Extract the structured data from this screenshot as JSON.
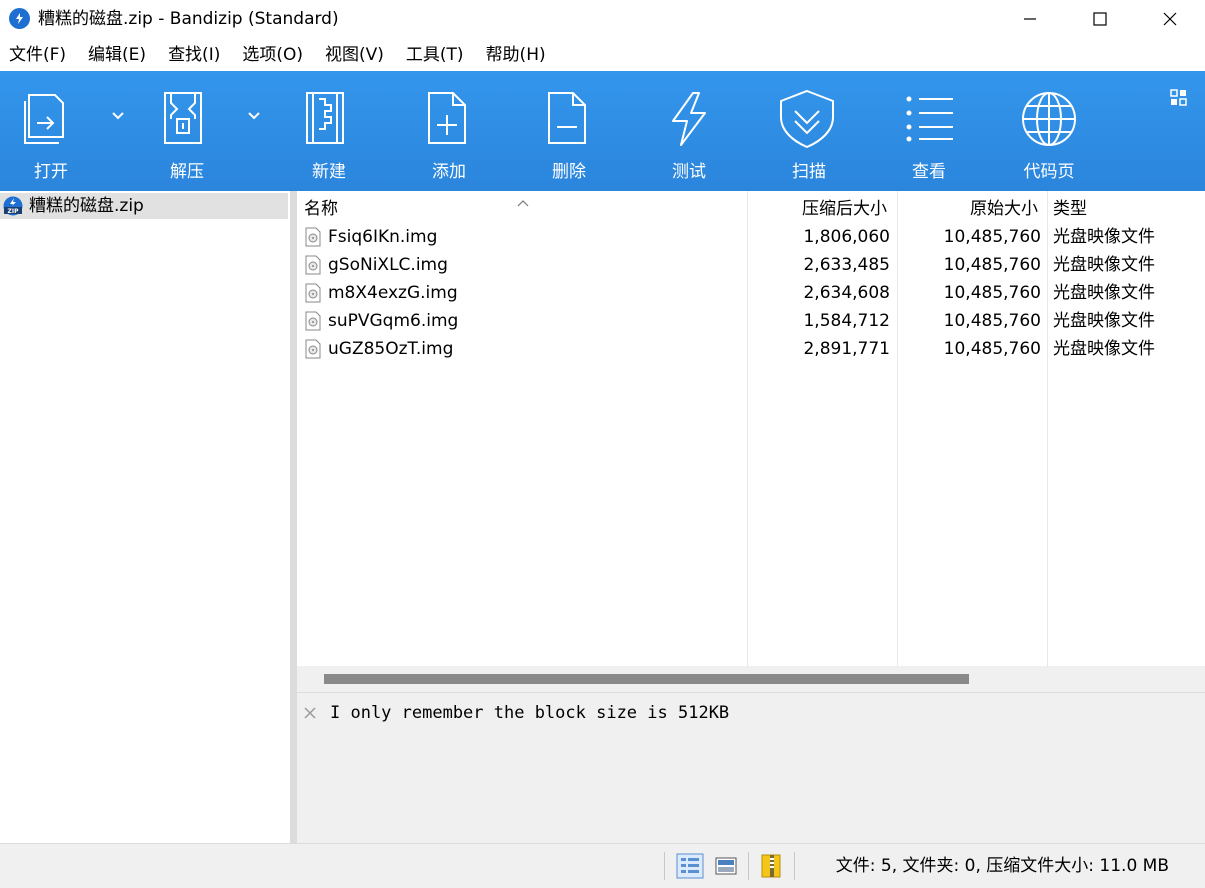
{
  "window": {
    "title": "糟糕的磁盘.zip - Bandizip (Standard)",
    "icon": "bandizip-app-icon",
    "controls": [
      "minimize-icon",
      "maximize-icon",
      "close-icon"
    ]
  },
  "menu": {
    "items": [
      "文件(F)",
      "编辑(E)",
      "查找(I)",
      "选项(O)",
      "视图(V)",
      "工具(T)",
      "帮助(H)"
    ]
  },
  "toolbar": {
    "background": "#2f8fe6",
    "buttons": [
      {
        "label": "打开",
        "icon": "open-archive-icon",
        "has_dropdown": true
      },
      {
        "label": "解压",
        "icon": "extract-icon",
        "has_dropdown": true
      },
      {
        "label": "新建",
        "icon": "new-archive-icon"
      },
      {
        "label": "添加",
        "icon": "add-file-icon"
      },
      {
        "label": "删除",
        "icon": "delete-file-icon"
      },
      {
        "label": "测试",
        "icon": "test-lightning-icon"
      },
      {
        "label": "扫描",
        "icon": "scan-shield-icon"
      },
      {
        "label": "查看",
        "icon": "view-list-icon"
      },
      {
        "label": "代码页",
        "icon": "codepage-globe-icon"
      }
    ],
    "layout_icon": "layout-grid-icon"
  },
  "tree": {
    "items": [
      {
        "label": "糟糕的磁盘.zip",
        "icon": "zip-icon",
        "selected": true
      }
    ]
  },
  "filelist": {
    "columns": {
      "name": "名称",
      "compressed": "压缩后大小",
      "original": "原始大小",
      "type": "类型"
    },
    "sort_column": "name",
    "rows": [
      {
        "name": "Fsiq6IKn.img",
        "compressed": "1,806,060",
        "original": "10,485,760",
        "type": "光盘映像文件"
      },
      {
        "name": "gSoNiXLC.img",
        "compressed": "2,633,485",
        "original": "10,485,760",
        "type": "光盘映像文件"
      },
      {
        "name": "m8X4exzG.img",
        "compressed": "2,634,608",
        "original": "10,485,760",
        "type": "光盘映像文件"
      },
      {
        "name": "suPVGqm6.img",
        "compressed": "1,584,712",
        "original": "10,485,760",
        "type": "光盘映像文件"
      },
      {
        "name": "uGZ85OzT.img",
        "compressed": "2,891,771",
        "original": "10,485,760",
        "type": "光盘映像文件"
      }
    ]
  },
  "comment": {
    "text": "I only remember the block size is 512KB"
  },
  "status": {
    "text": "文件: 5, 文件夹: 0, 压缩文件大小: 11.0 MB",
    "icons": [
      "details-view-icon",
      "thumbnail-view-icon",
      "archive-info-icon"
    ]
  }
}
